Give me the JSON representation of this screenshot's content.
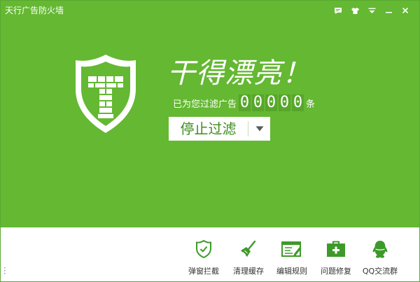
{
  "window": {
    "title": "天行广告防火墙"
  },
  "title_controls": [
    {
      "name": "message-icon"
    },
    {
      "name": "skin-icon"
    },
    {
      "name": "menu-icon"
    },
    {
      "name": "minimize-icon"
    },
    {
      "name": "close-icon"
    }
  ],
  "hero": {
    "headline": "干得漂亮！",
    "filter_prefix": "已为您过滤广告",
    "filter_count_digits": [
      "0",
      "0",
      "0",
      "0",
      "0"
    ],
    "filter_suffix": "条",
    "stop_button_label": "停止过滤",
    "logo_letter": "T"
  },
  "toolbar": {
    "items": [
      {
        "label": "弹窗拦截",
        "icon": "shield-check-icon"
      },
      {
        "label": "清理缓存",
        "icon": "broom-icon"
      },
      {
        "label": "编辑规则",
        "icon": "edit-rules-icon"
      },
      {
        "label": "问题修复",
        "icon": "first-aid-kit-icon"
      },
      {
        "label": "QQ交流群",
        "icon": "qq-penguin-icon"
      }
    ]
  },
  "colors": {
    "brand_green": "#64b832",
    "digit_bg": "#57a62a",
    "icon_green": "#3d9a2a"
  }
}
